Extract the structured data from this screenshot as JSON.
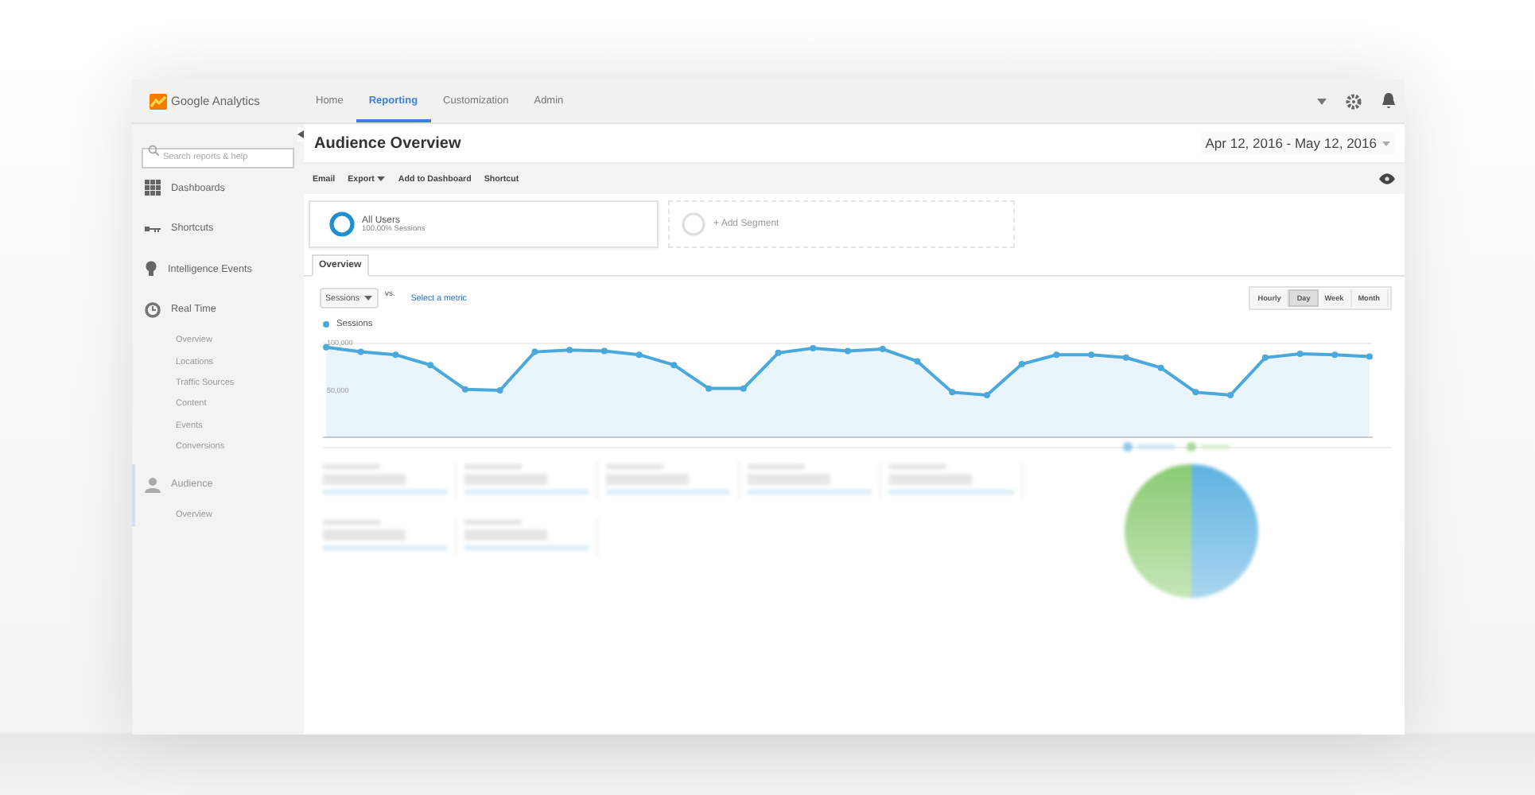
{
  "app": {
    "name": "Google Analytics"
  },
  "nav": [
    {
      "label": "Home",
      "selected": false
    },
    {
      "label": "Reporting",
      "selected": true
    },
    {
      "label": "Customization",
      "selected": false
    },
    {
      "label": "Admin",
      "selected": false
    }
  ],
  "sidebar": {
    "search": {
      "placeholder": "Search reports & help"
    },
    "items": [
      {
        "label": "Dashboards"
      },
      {
        "label": "Shortcuts"
      },
      {
        "label": "Intelligence Events"
      },
      {
        "label": "Real Time",
        "children": [
          {
            "label": "Overview"
          },
          {
            "label": "Locations"
          },
          {
            "label": "Traffic Sources"
          },
          {
            "label": "Content"
          },
          {
            "label": "Events"
          },
          {
            "label": "Conversions"
          }
        ]
      },
      {
        "label": "Audience",
        "children": [
          {
            "label": "Overview"
          }
        ]
      }
    ]
  },
  "report": {
    "title": "Audience Overview",
    "date_range": "Apr 12, 2016 - May 12, 2016",
    "actions": [
      {
        "label": "Email",
        "kind": "plain"
      },
      {
        "label": "Export",
        "kind": "menu"
      },
      {
        "label": "Add to Dashboard",
        "kind": "plain"
      },
      {
        "label": "Shortcut",
        "kind": "plain"
      }
    ],
    "segments": [
      {
        "name": "All Users",
        "detail": "100.00% Sessions",
        "kind": "active"
      },
      {
        "name": "+ Add Segment",
        "kind": "add"
      }
    ],
    "tabs": [
      {
        "label": "Overview",
        "selected": true
      }
    ],
    "metric_select": "Sessions",
    "vs": "vs.",
    "select_metric": "Select a metric",
    "granularity": [
      {
        "label": "Hourly",
        "selected": false
      },
      {
        "label": "Day",
        "selected": true
      },
      {
        "label": "Week",
        "selected": false
      },
      {
        "label": "Month",
        "selected": false
      }
    ],
    "chart": {
      "chart_data": {
        "type": "area",
        "series": [
          {
            "name": "Sessions",
            "color": "#4aa8db",
            "values": [
              96000,
              91000,
              88000,
              77000,
              51000,
              50000,
              91000,
              93000,
              92000,
              88000,
              77000,
              52000,
              52000,
              90000,
              95000,
              92000,
              94000,
              81000,
              48000,
              45000,
              78000,
              88000,
              88000,
              85000,
              74000,
              48000,
              45000,
              85000,
              89000,
              88000,
              86000
            ]
          }
        ],
        "ylim": [
          0,
          100000
        ],
        "yticks": [
          {
            "value": 50000,
            "label": "50,000"
          },
          {
            "value": 100000,
            "label": "100,000"
          }
        ]
      }
    }
  }
}
